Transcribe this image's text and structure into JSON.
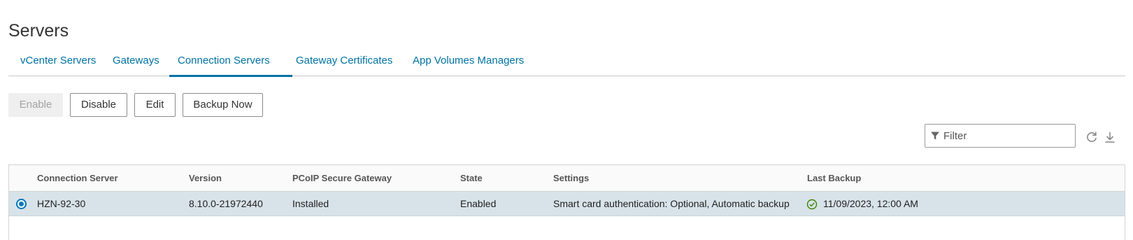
{
  "page": {
    "title": "Servers"
  },
  "tabs": [
    {
      "label": "vCenter Servers",
      "active": false
    },
    {
      "label": "Gateways",
      "active": false
    },
    {
      "label": "Connection Servers",
      "active": true
    },
    {
      "label": "Gateway Certificates",
      "active": false
    },
    {
      "label": "App Volumes Managers",
      "active": false
    }
  ],
  "toolbar": {
    "enable_label": "Enable",
    "disable_label": "Disable",
    "edit_label": "Edit",
    "backup_now_label": "Backup Now"
  },
  "filter": {
    "placeholder": "Filter",
    "icon": "filter-icon"
  },
  "actions": {
    "refresh_icon": "refresh-icon",
    "export_icon": "download-icon"
  },
  "table": {
    "columns": [
      "Connection Server",
      "Version",
      "PCoIP Secure Gateway",
      "State",
      "Settings",
      "Last Backup"
    ],
    "rows": [
      {
        "selected": true,
        "connection_server": "HZN-92-30",
        "version": "8.10.0-21972440",
        "pcoip_secure_gateway": "Installed",
        "state": "Enabled",
        "settings": "Smart card authentication: Optional, Automatic backup",
        "last_backup_status_icon": "check-circle-icon",
        "last_backup": "11/09/2023, 12:00 AM"
      }
    ]
  },
  "colors": {
    "accent": "#0072a3",
    "selected_row": "#d8e3e9",
    "success": "#3c8500"
  }
}
